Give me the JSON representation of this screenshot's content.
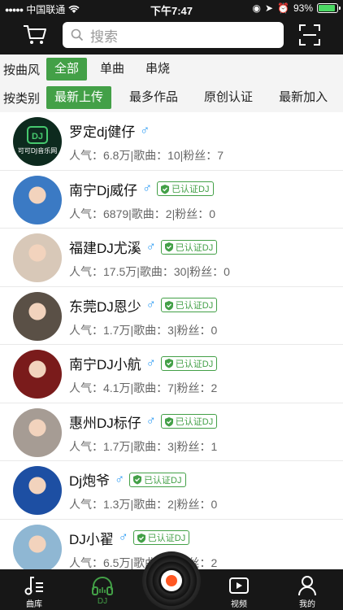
{
  "status": {
    "carrier": "中国联通",
    "time": "下午7:47",
    "battery": "93%",
    "battery_level": 0.93
  },
  "search": {
    "placeholder": "搜索"
  },
  "filters": {
    "style_label": "按曲风",
    "styles": [
      "全部",
      "单曲",
      "串烧"
    ],
    "category_label": "按类别",
    "categories": [
      "最新上传",
      "最多作品",
      "原创认证",
      "最新加入"
    ]
  },
  "list": [
    {
      "name": "罗定dj健仔",
      "verified": false,
      "stats": "人气：6.8万|歌曲：10|粉丝：7",
      "avatar_color": "#0d2a1e",
      "avatar_text": "可可DJ音乐网"
    },
    {
      "name": "南宁Dj威仔",
      "verified": true,
      "stats": "人气：6879|歌曲：2|粉丝：0",
      "avatar_color": "#3b7ac4",
      "avatar_text": ""
    },
    {
      "name": "福建DJ尤溪",
      "verified": true,
      "stats": "人气：17.5万|歌曲：30|粉丝：0",
      "avatar_color": "#d8c8b8",
      "avatar_text": ""
    },
    {
      "name": "东莞DJ恩少",
      "verified": true,
      "stats": "人气：1.7万|歌曲：3|粉丝：0",
      "avatar_color": "#5a5046",
      "avatar_text": ""
    },
    {
      "name": "南宁DJ小航",
      "verified": true,
      "stats": "人气：4.1万|歌曲：7|粉丝：2",
      "avatar_color": "#7a1b1b",
      "avatar_text": ""
    },
    {
      "name": "惠州DJ标仔",
      "verified": true,
      "stats": "人气：1.7万|歌曲：3|粉丝：1",
      "avatar_color": "#a69c94",
      "avatar_text": ""
    },
    {
      "name": "Dj炮爷",
      "verified": true,
      "stats": "人气：1.3万|歌曲：2|粉丝：0",
      "avatar_color": "#1d4fa3",
      "avatar_text": ""
    },
    {
      "name": "DJ小翟",
      "verified": true,
      "stats": "人气：6.5万|歌曲：1|粉丝：2",
      "avatar_color": "#8fb7d3",
      "avatar_text": ""
    }
  ],
  "verified_label": "已认证DJ",
  "tabs": [
    "曲库",
    "DJ",
    "视频",
    "我的"
  ],
  "colors": {
    "accent": "#43a047",
    "male": "#2196f3",
    "dark": "#171717"
  }
}
